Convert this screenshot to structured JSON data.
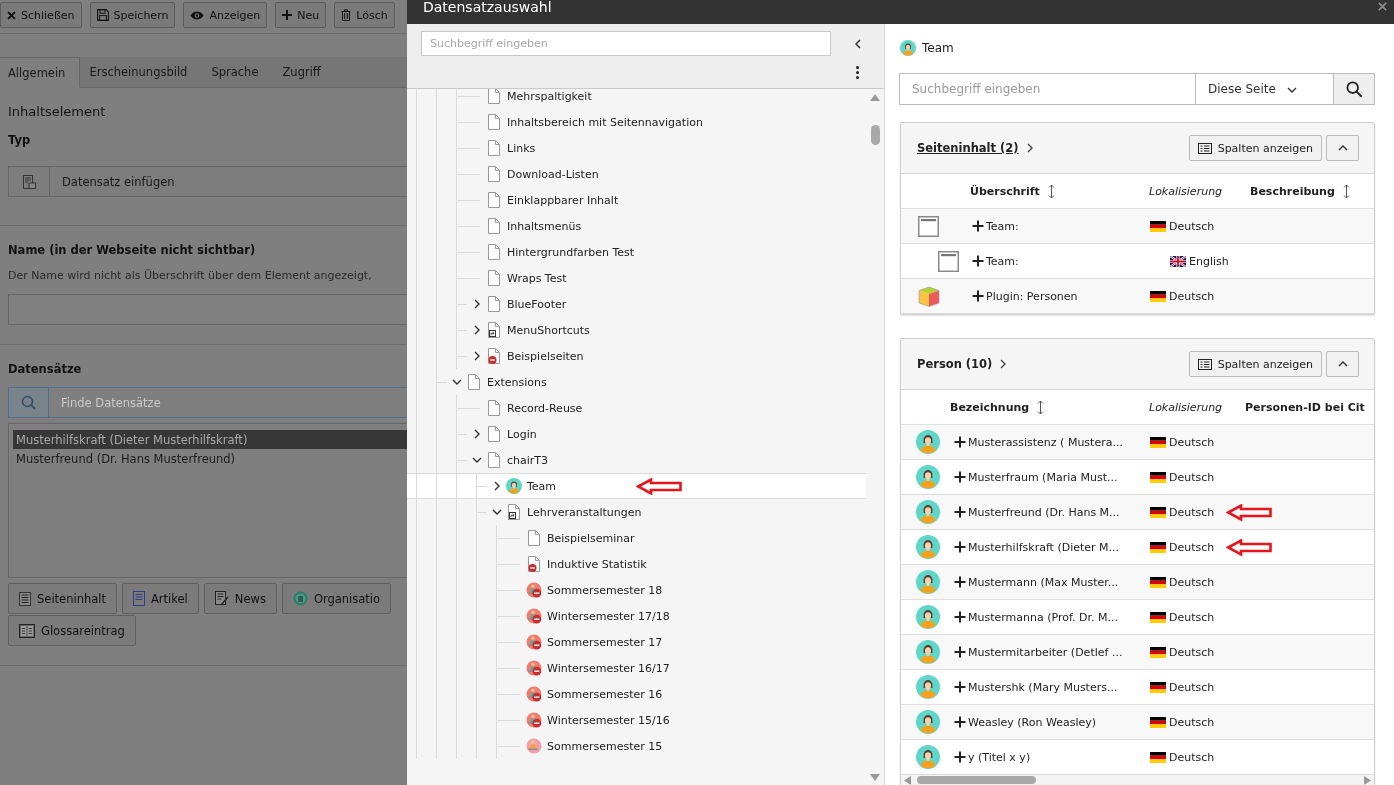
{
  "editor": {
    "toolbar": [
      {
        "kind": "close",
        "label": "Schließen"
      },
      {
        "kind": "save",
        "label": "Speichern"
      },
      {
        "kind": "view",
        "label": "Anzeigen"
      },
      {
        "kind": "new",
        "label": "Neu"
      },
      {
        "kind": "delete",
        "label": "Lösch"
      }
    ],
    "tabs": [
      {
        "label": "Allgemein",
        "selected": true
      },
      {
        "label": "Erscheinungsbild",
        "selected": false
      },
      {
        "label": "Sprache",
        "selected": false
      },
      {
        "label": "Zugriff",
        "selected": false
      }
    ],
    "section_title": "Inhaltselement",
    "type_field": {
      "label": "Typ",
      "value": "Datensatz einfügen"
    },
    "name_field": {
      "label": "Name (in der Webseite nicht sichtbar)",
      "description": "Der Name wird nicht als Überschrift über dem Element angezeigt,"
    },
    "records": {
      "label": "Datensätze",
      "search": {
        "placeholder": "Finde Datensätze"
      },
      "items": [
        {
          "label": "Musterhilfskraft (Dieter Musterhilfskraft)",
          "selected": true
        },
        {
          "label": "Musterfreund (Dr. Hans Musterfreund)",
          "selected": false
        }
      ],
      "add_buttons": [
        {
          "kind": "content",
          "label": "Seiteninhalt"
        },
        {
          "kind": "article",
          "label": "Artikel"
        },
        {
          "kind": "news",
          "label": "News"
        },
        {
          "kind": "organisation",
          "label": "Organisatio"
        },
        {
          "kind": "glossary",
          "label": "Glossareintrag"
        }
      ]
    }
  },
  "dialog": {
    "title": "Datensatzauswahl",
    "tree": {
      "search": {
        "placeholder": "Suchbegriff eingeben"
      },
      "items": [
        {
          "children": [
            {
              "label": "Mehrspaltigkeit",
              "kind": "page",
              "hidden": false,
              "selected": false,
              "marked": false
            },
            {
              "label": "Inhaltsbereich mit Seitennavigation",
              "kind": "page",
              "hidden": false,
              "selected": false,
              "marked": false
            },
            {
              "label": "Links",
              "kind": "page",
              "hidden": false,
              "selected": false,
              "marked": false
            },
            {
              "label": "Download-Listen",
              "kind": "page",
              "hidden": false,
              "selected": false,
              "marked": false
            },
            {
              "label": "Einklappbarer Inhalt",
              "kind": "page",
              "hidden": false,
              "selected": false,
              "marked": false
            },
            {
              "label": "Inhaltsmenüs",
              "kind": "page",
              "hidden": false,
              "selected": false,
              "marked": false
            },
            {
              "label": "Hintergrundfarben Test",
              "kind": "page",
              "hidden": false,
              "selected": false,
              "marked": false
            },
            {
              "label": "Wraps Test",
              "kind": "page",
              "hidden": false,
              "selected": false,
              "marked": false
            },
            {
              "label": "BlueFooter",
              "kind": "page",
              "hidden": false,
              "selected": false,
              "marked": false,
              "expanded": false
            },
            {
              "label": "MenuShortcuts",
              "kind": "shortcut",
              "hidden": false,
              "selected": false,
              "marked": false,
              "expanded": false
            },
            {
              "label": "Beispielseiten",
              "kind": "page",
              "hidden": true,
              "selected": false,
              "marked": false,
              "expanded": false
            }
          ]
        },
        {
          "label": "Extensions",
          "kind": "page",
          "hidden": false,
          "selected": false,
          "marked": false,
          "expanded": true,
          "children": [
            {
              "label": "Record-Reuse",
              "kind": "page",
              "hidden": false,
              "selected": false,
              "marked": false
            },
            {
              "label": "Login",
              "kind": "page",
              "hidden": false,
              "selected": false,
              "marked": false,
              "expanded": false
            },
            {
              "label": "chairT3",
              "kind": "page",
              "hidden": false,
              "selected": false,
              "marked": false,
              "expanded": true,
              "children": [
                {
                  "label": "Team",
                  "kind": "person",
                  "hidden": false,
                  "selected": true,
                  "marked": true,
                  "expanded": false
                },
                {
                  "label": "Lehrveranstaltungen",
                  "kind": "shortcut",
                  "hidden": false,
                  "selected": false,
                  "marked": false,
                  "expanded": true,
                  "children": [
                    {
                      "label": "Beispielseminar",
                      "kind": "page",
                      "hidden": false,
                      "selected": false,
                      "marked": false
                    },
                    {
                      "label": "Induktive Statistik",
                      "kind": "page",
                      "hidden": true,
                      "selected": false,
                      "marked": false
                    },
                    {
                      "label": "Sommersemester 18",
                      "kind": "event",
                      "hidden": true,
                      "selected": false,
                      "marked": false
                    },
                    {
                      "label": "Wintersemester 17/18",
                      "kind": "event",
                      "hidden": true,
                      "selected": false,
                      "marked": false
                    },
                    {
                      "label": "Sommersemester 17",
                      "kind": "event",
                      "hidden": true,
                      "selected": false,
                      "marked": false
                    },
                    {
                      "label": "Wintersemester 16/17",
                      "kind": "event",
                      "hidden": true,
                      "selected": false,
                      "marked": false
                    },
                    {
                      "label": "Sommersemester 16",
                      "kind": "event",
                      "hidden": true,
                      "selected": false,
                      "marked": false
                    },
                    {
                      "label": "Wintersemester 15/16",
                      "kind": "event",
                      "hidden": true,
                      "selected": false,
                      "marked": false
                    },
                    {
                      "label": "Sommersemester 15",
                      "kind": "event",
                      "hidden": false,
                      "selected": false,
                      "marked": false
                    }
                  ]
                }
              ]
            }
          ]
        }
      ]
    },
    "browser": {
      "page_title": "Team",
      "search": {
        "placeholder": "Suchbegriff eingeben",
        "scope": "Diese Seite"
      },
      "tables": [
        {
          "title": "Seiteninhalt (2)",
          "hovered": true,
          "columns_button": "Spalten anzeigen",
          "expanded": true,
          "columns": [
            {
              "label": "Überschrift",
              "kind": "field",
              "sortable": true
            },
            {
              "label": "Lokalisierung",
              "kind": "localization",
              "sortable": false
            },
            {
              "label": "Beschreibung",
              "kind": "field",
              "sortable": true
            }
          ],
          "rows": [
            {
              "kind": "content",
              "title": "Team:",
              "translation": false,
              "marked": false,
              "language": {
                "kind": "de",
                "label": "Deutsch"
              }
            },
            {
              "kind": "content",
              "title": "Team:",
              "translation": true,
              "marked": false,
              "language": {
                "kind": "gb",
                "label": "English"
              }
            },
            {
              "kind": "plugin",
              "title": "Plugin: Personen",
              "translation": false,
              "marked": false,
              "language": {
                "kind": "de",
                "label": "Deutsch"
              }
            }
          ]
        },
        {
          "title": "Person (10)",
          "hovered": false,
          "columns_button": "Spalten anzeigen",
          "expanded": true,
          "columns": [
            {
              "label": "Bezeichnung",
              "kind": "field",
              "sortable": true
            },
            {
              "label": "Lokalisierung",
              "kind": "localization",
              "sortable": false
            },
            {
              "label": "Personen-ID bei Cit",
              "kind": "field",
              "sortable": false
            }
          ],
          "rows": [
            {
              "kind": "person",
              "title": "Musterassistenz ( Mustera...",
              "translation": false,
              "marked": false,
              "language": {
                "kind": "de",
                "label": "Deutsch"
              }
            },
            {
              "kind": "person",
              "title": "Musterfraum (Maria Must...",
              "translation": false,
              "marked": false,
              "language": {
                "kind": "de",
                "label": "Deutsch"
              }
            },
            {
              "kind": "person",
              "title": "Musterfreund (Dr. Hans M...",
              "translation": false,
              "marked": true,
              "language": {
                "kind": "de",
                "label": "Deutsch"
              }
            },
            {
              "kind": "person",
              "title": "Musterhilfskraft (Dieter M...",
              "translation": false,
              "marked": true,
              "language": {
                "kind": "de",
                "label": "Deutsch"
              }
            },
            {
              "kind": "person",
              "title": "Mustermann (Max Muster...",
              "translation": false,
              "marked": false,
              "language": {
                "kind": "de",
                "label": "Deutsch"
              }
            },
            {
              "kind": "person",
              "title": "Mustermanna (Prof. Dr. M...",
              "translation": false,
              "marked": false,
              "language": {
                "kind": "de",
                "label": "Deutsch"
              }
            },
            {
              "kind": "person",
              "title": "Mustermitarbeiter (Detlef ...",
              "translation": false,
              "marked": false,
              "language": {
                "kind": "de",
                "label": "Deutsch"
              }
            },
            {
              "kind": "person",
              "title": "Mustershk (Mary Musters...",
              "translation": false,
              "marked": false,
              "language": {
                "kind": "de",
                "label": "Deutsch"
              }
            },
            {
              "kind": "person",
              "title": "Weasley (Ron Weasley)",
              "translation": false,
              "marked": false,
              "language": {
                "kind": "de",
                "label": "Deutsch"
              }
            },
            {
              "kind": "person",
              "title": "y (Titel x y)",
              "translation": false,
              "marked": false,
              "language": {
                "kind": "de",
                "label": "Deutsch"
              }
            }
          ]
        }
      ]
    }
  }
}
